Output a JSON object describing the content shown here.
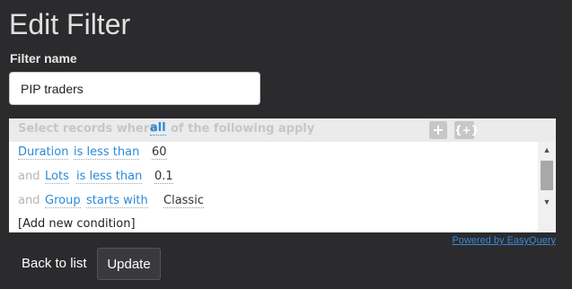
{
  "page": {
    "title": "Edit Filter"
  },
  "form": {
    "name_label": "Filter name",
    "name_value": "PIP traders"
  },
  "filter": {
    "header": {
      "prefix": "Select records where",
      "quantifier": "all",
      "suffix": "of the following apply",
      "add_icon": "+",
      "group_icon": "{+}"
    },
    "conditions": [
      {
        "conj": "",
        "field": "Duration",
        "op": "is less than",
        "value": "60"
      },
      {
        "conj": "and",
        "field": "Lots",
        "op": "is less than",
        "value": "0.1"
      },
      {
        "conj": "and",
        "field": "Group",
        "op": "starts with",
        "value": "Classic"
      }
    ],
    "add_condition": "[Add new condition]",
    "powered_by": "Powered by EasyQuery"
  },
  "actions": {
    "back": "Back to list",
    "update": "Update"
  },
  "icons": {
    "add": "plus-icon",
    "group": "group-add-icon",
    "scroll_up": "scroll-up-arrow",
    "scroll_down": "scroll-down-arrow"
  },
  "colors": {
    "link": "#2a8ad8",
    "background": "#2b2b2e"
  }
}
